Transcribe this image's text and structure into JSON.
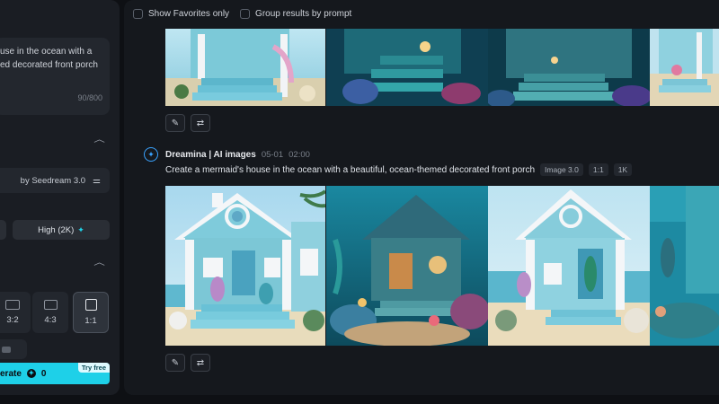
{
  "sidebar": {
    "prompt_text": "use in the ocean with a\ned decorated front porch",
    "prompt_count": "90/800",
    "model_label": "by Seedream 3.0",
    "resolution_label": "High (2K)",
    "ratios": [
      {
        "label": "3:2",
        "active": false
      },
      {
        "label": "4:3",
        "active": false
      },
      {
        "label": "1:1",
        "active": true
      }
    ],
    "generate_label": "erate",
    "generate_cost": "0",
    "try_free_label": "Try free"
  },
  "filters": {
    "favorites_label": "Show Favorites only",
    "group_label": "Group results by prompt"
  },
  "generation": {
    "source": "Dreamina | AI images",
    "date": "05-01",
    "time": "02:00",
    "prompt": "Create a mermaid's house in the ocean with a beautiful, ocean-themed decorated front porch",
    "tags": [
      "Image 3.0",
      "1:1",
      "1K"
    ]
  },
  "icons": {
    "edit": "pencil-icon",
    "regenerate": "regenerate-icon",
    "settings": "sliders-icon",
    "collapse": "chevron-up-icon",
    "brand": "dreamina-logo-icon",
    "sparkle": "sparkle-icon",
    "coin": "coin-icon"
  },
  "colors": {
    "accent": "#1ed0e8",
    "brand_blue": "#3aa3ff",
    "panel": "#1a1d23",
    "background": "#0e1014"
  }
}
